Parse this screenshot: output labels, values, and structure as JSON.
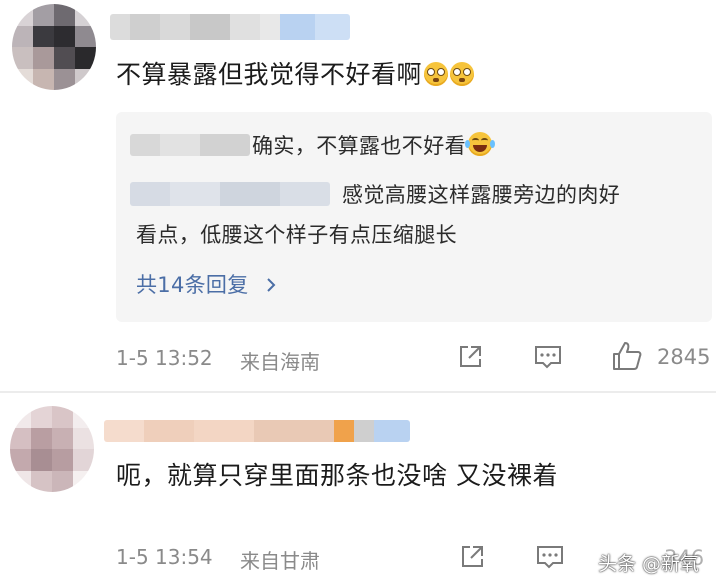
{
  "comments": [
    {
      "text": "不算暴露但我觉得不好看啊",
      "emojis": [
        "flushed-face",
        "flushed-face"
      ],
      "replies": [
        {
          "text": "确实，不算露也不好看",
          "emoji": "laughing-face"
        },
        {
          "text_line1": "感觉高腰这样露腰旁边的肉好",
          "text_line2": "看点，低腰这个样子有点压缩腿长"
        }
      ],
      "more_replies_label": "共14条回复",
      "timestamp": "1-5 13:52",
      "location": "来自海南",
      "like_count": "2845"
    },
    {
      "text": "呃，就算只穿里面那条也没啥 又没裸着",
      "timestamp": "1-5 13:54",
      "location": "来自甘肃",
      "like_count": "346"
    }
  ],
  "watermark": "头条 @新氧",
  "colors": {
    "link": "#4b6ea6",
    "meta_gray": "#8a8a8a",
    "reply_bg": "#f5f5f5",
    "emoji_yellow": "#f6c43c"
  }
}
